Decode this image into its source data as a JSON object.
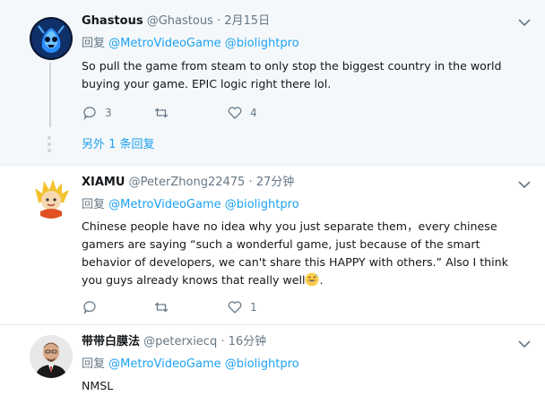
{
  "tweets": [
    {
      "name": "Ghastous",
      "handle": "@Ghastous",
      "separator": "·",
      "time": "2月15日",
      "reply_prefix": "回复",
      "reply_to_1": "@MetroVideoGame",
      "reply_to_2": "@biolightpro",
      "text": "So pull the game from steam to only stop the biggest country in the world buying your game.  EPIC logic right there lol.",
      "replies": "3",
      "retweets": "",
      "likes": "4",
      "more_replies": "另外 1 条回复"
    },
    {
      "name": "XIAMU",
      "handle": "@PeterZhong22475",
      "separator": "·",
      "time": "27分钟",
      "reply_prefix": "回复",
      "reply_to_1": "@MetroVideoGame",
      "reply_to_2": "@biolightpro",
      "text": "Chinese people have no idea why you just separate them，every chinese gamers are saying “such a wonderful game, just because of the smart behavior of developers, we can't share this HAPPY with others.” Also I think you guys already knows that really well",
      "text_end": ".",
      "emoji": "grinning-sweat-emoji",
      "replies": "",
      "retweets": "",
      "likes": "1"
    },
    {
      "name": "带带白膜法",
      "handle": "@peterxiecq",
      "separator": "·",
      "time": "16分钟",
      "reply_prefix": "回复",
      "reply_to_1": "@MetroVideoGame",
      "reply_to_2": "@biolightpro",
      "text": "NMSL"
    }
  ],
  "colors": {
    "link": "#1da1f2",
    "muted": "#657786",
    "highlight_bg": "#f5f8fa"
  }
}
